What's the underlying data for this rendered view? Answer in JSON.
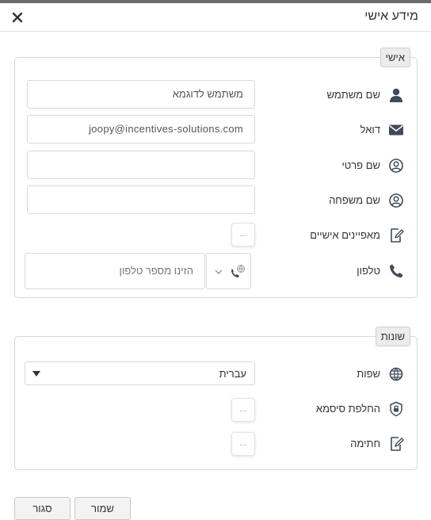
{
  "dialog": {
    "title": "מידע אישי"
  },
  "personal_section": {
    "legend": "אישי",
    "rows": {
      "username": {
        "label": "שם משתמש",
        "value": "משתמש לדוגמא"
      },
      "email": {
        "label": "דואל",
        "value": "joopy@incentives-solutions.com"
      },
      "first_name": {
        "label": "שם פרטי",
        "value": ""
      },
      "last_name": {
        "label": "שם משפחה",
        "value": ""
      },
      "attributes": {
        "label": "מאפיינים אישיים",
        "button": "..."
      },
      "phone": {
        "label": "טלפון",
        "placeholder": "הזינו מספר טלפון"
      }
    }
  },
  "misc_section": {
    "legend": "שונות",
    "rows": {
      "language": {
        "label": "שפות",
        "value": "עברית"
      },
      "password": {
        "label": "החלפת סיסמא",
        "button": "..."
      },
      "signature": {
        "label": "חתימה",
        "button": "..."
      }
    }
  },
  "footer": {
    "save": "שמור",
    "close": "סגור"
  },
  "icons": {
    "close": "close-icon",
    "user": "user-icon",
    "email": "envelope-icon",
    "first_name": "user-circle-icon",
    "last_name": "user-circle-icon",
    "attributes": "edit-document-icon",
    "phone": "phone-icon",
    "phone_country": "phone-globe-icon",
    "language": "globe-icon",
    "password": "shield-lock-icon",
    "signature": "edit-document-icon"
  },
  "colors": {
    "icon": "#3f4a5a",
    "border": "#d7d7d7",
    "legend_bg": "#ececec",
    "button_bg": "#f3f3f3"
  }
}
